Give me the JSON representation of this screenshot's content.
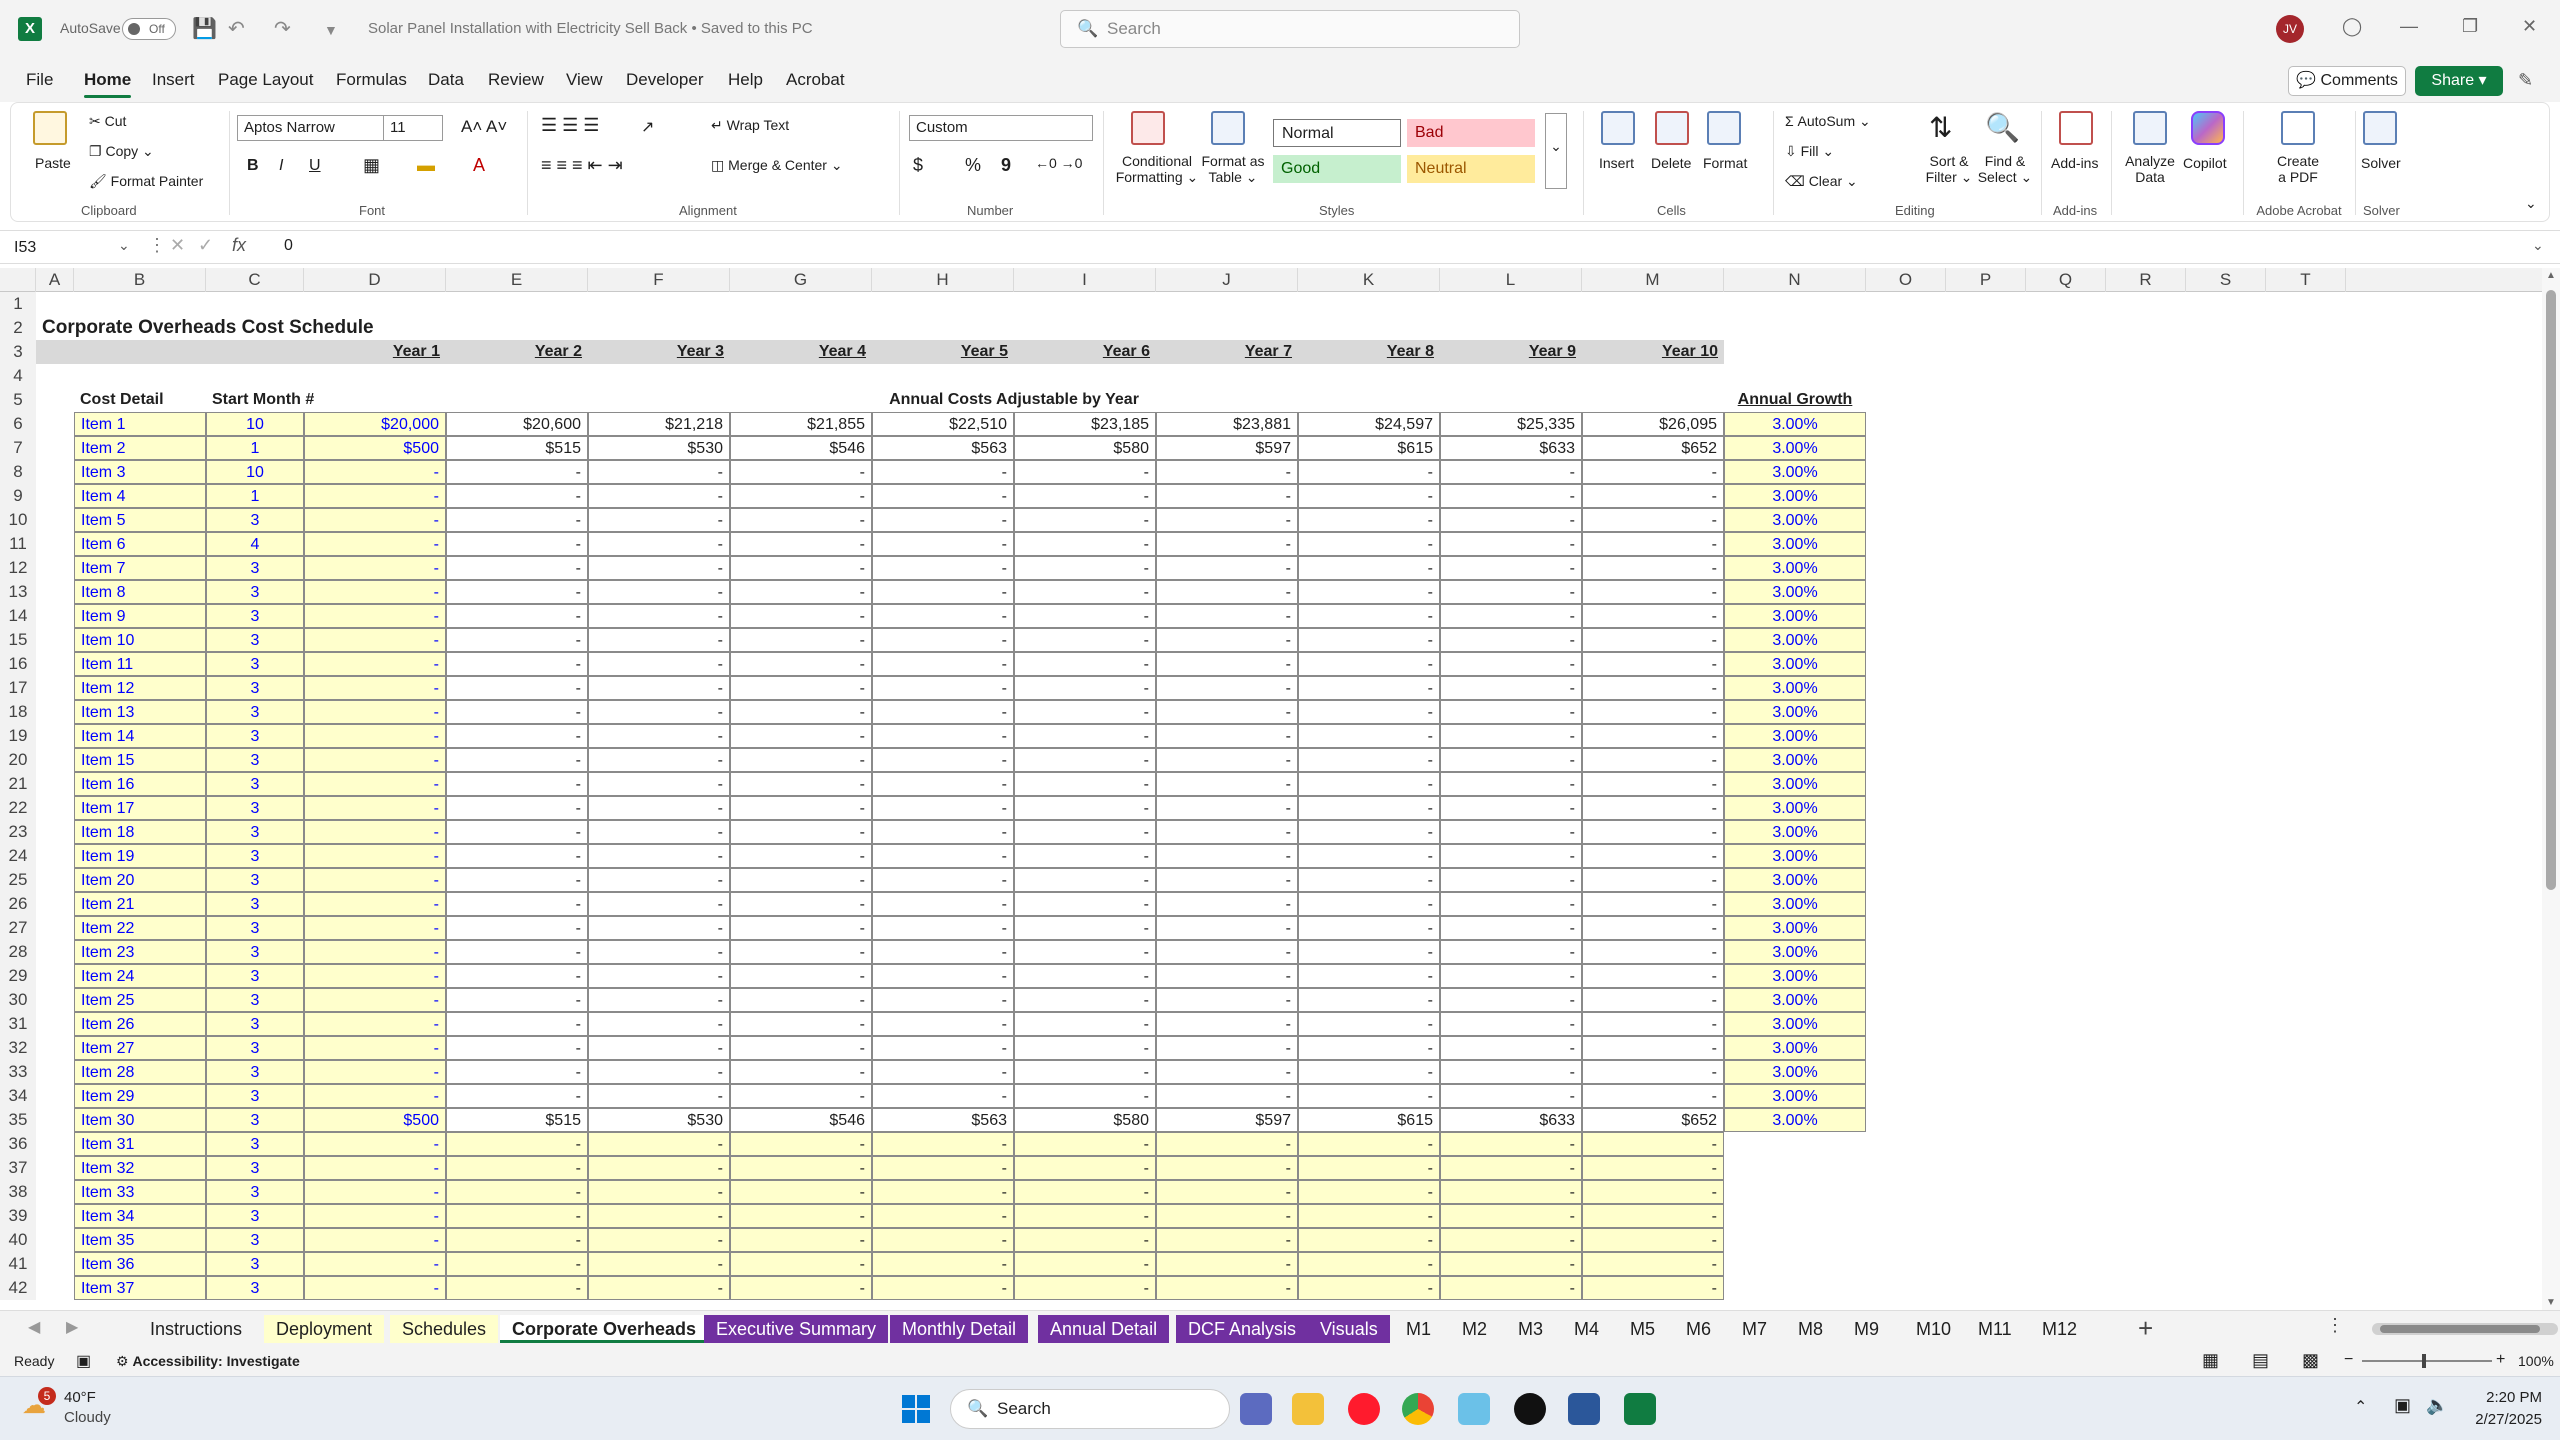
{
  "titlebar": {
    "app_icon": "X",
    "autosave_label": "AutoSave",
    "autosave_state": "Off",
    "document_title": "Solar Panel Installation with Electricity Sell Back • Saved to this PC",
    "search_placeholder": "Search",
    "user_initials": "JV"
  },
  "menu": [
    "File",
    "Home",
    "Insert",
    "Page Layout",
    "Formulas",
    "Data",
    "Review",
    "View",
    "Developer",
    "Help",
    "Acrobat"
  ],
  "menu_active": "Home",
  "actions": {
    "comments": "Comments",
    "share": "Share"
  },
  "ribbon": {
    "clipboard": {
      "paste": "Paste",
      "cut": "Cut",
      "copy": "Copy",
      "format_painter": "Format Painter",
      "label": "Clipboard"
    },
    "font": {
      "name": "Aptos Narrow",
      "size": "11",
      "bold": "B",
      "italic": "I",
      "underline": "U",
      "label": "Font"
    },
    "alignment": {
      "wrap": "Wrap Text",
      "merge": "Merge & Center",
      "label": "Alignment"
    },
    "number": {
      "format": "Custom",
      "currency": "$",
      "percent": "%",
      "comma": "9",
      "label": "Number"
    },
    "styles": {
      "conditional": "Conditional",
      "conditional2": "Formatting",
      "format_table": "Format as",
      "format_table2": "Table",
      "normal": "Normal",
      "bad": "Bad",
      "good": "Good",
      "neutral": "Neutral",
      "label": "Styles"
    },
    "cells": {
      "insert": "Insert",
      "delete": "Delete",
      "format": "Format",
      "label": "Cells"
    },
    "editing": {
      "autosum": "AutoSum",
      "fill": "Fill",
      "clear": "Clear",
      "sort": "Sort &",
      "sort2": "Filter",
      "find": "Find &",
      "find2": "Select",
      "label": "Editing"
    },
    "addins": {
      "addins": "Add-ins",
      "label": "Add-ins"
    },
    "analyze": {
      "line1": "Analyze",
      "line2": "Data"
    },
    "copilot": "Copilot",
    "acrobat": {
      "line1": "Create",
      "line2": "a PDF",
      "label": "Adobe Acrobat"
    },
    "solver": {
      "btn": "Solver",
      "label": "Solver"
    }
  },
  "formula_bar": {
    "cell_ref": "I53",
    "fx": "fx",
    "value": "0"
  },
  "columns": [
    "A",
    "B",
    "C",
    "D",
    "E",
    "F",
    "G",
    "H",
    "I",
    "J",
    "K",
    "L",
    "M",
    "N",
    "O",
    "P",
    "Q",
    "R",
    "S",
    "T"
  ],
  "sheet": {
    "title": "Corporate Overheads Cost Schedule",
    "years": [
      "Year 1",
      "Year 2",
      "Year 3",
      "Year 4",
      "Year 5",
      "Year 6",
      "Year 7",
      "Year 8",
      "Year 9",
      "Year 10"
    ],
    "cost_detail_label": "Cost Detail",
    "start_month_label": "Start Month #",
    "annual_costs_label": "Annual Costs Adjustable by Year",
    "annual_growth_label": "Annual Growth",
    "items": [
      {
        "name": "Item 1",
        "start": "10",
        "vals": [
          "$20,000",
          "$20,600",
          "$21,218",
          "$21,855",
          "$22,510",
          "$23,185",
          "$23,881",
          "$24,597",
          "$25,335",
          "$26,095"
        ],
        "growth": "3.00%"
      },
      {
        "name": "Item 2",
        "start": "1",
        "vals": [
          "$500",
          "$515",
          "$530",
          "$546",
          "$563",
          "$580",
          "$597",
          "$615",
          "$633",
          "$652"
        ],
        "growth": "3.00%"
      },
      {
        "name": "Item 3",
        "start": "10",
        "vals": [
          "-",
          "-",
          "-",
          "-",
          "-",
          "-",
          "-",
          "-",
          "-",
          "-"
        ],
        "growth": "3.00%"
      },
      {
        "name": "Item 4",
        "start": "1",
        "vals": [
          "-",
          "-",
          "-",
          "-",
          "-",
          "-",
          "-",
          "-",
          "-",
          "-"
        ],
        "growth": "3.00%"
      },
      {
        "name": "Item 5",
        "start": "3",
        "vals": [
          "-",
          "-",
          "-",
          "-",
          "-",
          "-",
          "-",
          "-",
          "-",
          "-"
        ],
        "growth": "3.00%"
      },
      {
        "name": "Item 6",
        "start": "4",
        "vals": [
          "-",
          "-",
          "-",
          "-",
          "-",
          "-",
          "-",
          "-",
          "-",
          "-"
        ],
        "growth": "3.00%"
      },
      {
        "name": "Item 7",
        "start": "3",
        "vals": [
          "-",
          "-",
          "-",
          "-",
          "-",
          "-",
          "-",
          "-",
          "-",
          "-"
        ],
        "growth": "3.00%"
      },
      {
        "name": "Item 8",
        "start": "3",
        "vals": [
          "-",
          "-",
          "-",
          "-",
          "-",
          "-",
          "-",
          "-",
          "-",
          "-"
        ],
        "growth": "3.00%"
      },
      {
        "name": "Item 9",
        "start": "3",
        "vals": [
          "-",
          "-",
          "-",
          "-",
          "-",
          "-",
          "-",
          "-",
          "-",
          "-"
        ],
        "growth": "3.00%"
      },
      {
        "name": "Item 10",
        "start": "3",
        "vals": [
          "-",
          "-",
          "-",
          "-",
          "-",
          "-",
          "-",
          "-",
          "-",
          "-"
        ],
        "growth": "3.00%"
      },
      {
        "name": "Item 11",
        "start": "3",
        "vals": [
          "-",
          "-",
          "-",
          "-",
          "-",
          "-",
          "-",
          "-",
          "-",
          "-"
        ],
        "growth": "3.00%"
      },
      {
        "name": "Item 12",
        "start": "3",
        "vals": [
          "-",
          "-",
          "-",
          "-",
          "-",
          "-",
          "-",
          "-",
          "-",
          "-"
        ],
        "growth": "3.00%"
      },
      {
        "name": "Item 13",
        "start": "3",
        "vals": [
          "-",
          "-",
          "-",
          "-",
          "-",
          "-",
          "-",
          "-",
          "-",
          "-"
        ],
        "growth": "3.00%"
      },
      {
        "name": "Item 14",
        "start": "3",
        "vals": [
          "-",
          "-",
          "-",
          "-",
          "-",
          "-",
          "-",
          "-",
          "-",
          "-"
        ],
        "growth": "3.00%"
      },
      {
        "name": "Item 15",
        "start": "3",
        "vals": [
          "-",
          "-",
          "-",
          "-",
          "-",
          "-",
          "-",
          "-",
          "-",
          "-"
        ],
        "growth": "3.00%"
      },
      {
        "name": "Item 16",
        "start": "3",
        "vals": [
          "-",
          "-",
          "-",
          "-",
          "-",
          "-",
          "-",
          "-",
          "-",
          "-"
        ],
        "growth": "3.00%"
      },
      {
        "name": "Item 17",
        "start": "3",
        "vals": [
          "-",
          "-",
          "-",
          "-",
          "-",
          "-",
          "-",
          "-",
          "-",
          "-"
        ],
        "growth": "3.00%"
      },
      {
        "name": "Item 18",
        "start": "3",
        "vals": [
          "-",
          "-",
          "-",
          "-",
          "-",
          "-",
          "-",
          "-",
          "-",
          "-"
        ],
        "growth": "3.00%"
      },
      {
        "name": "Item 19",
        "start": "3",
        "vals": [
          "-",
          "-",
          "-",
          "-",
          "-",
          "-",
          "-",
          "-",
          "-",
          "-"
        ],
        "growth": "3.00%"
      },
      {
        "name": "Item 20",
        "start": "3",
        "vals": [
          "-",
          "-",
          "-",
          "-",
          "-",
          "-",
          "-",
          "-",
          "-",
          "-"
        ],
        "growth": "3.00%"
      },
      {
        "name": "Item 21",
        "start": "3",
        "vals": [
          "-",
          "-",
          "-",
          "-",
          "-",
          "-",
          "-",
          "-",
          "-",
          "-"
        ],
        "growth": "3.00%"
      },
      {
        "name": "Item 22",
        "start": "3",
        "vals": [
          "-",
          "-",
          "-",
          "-",
          "-",
          "-",
          "-",
          "-",
          "-",
          "-"
        ],
        "growth": "3.00%"
      },
      {
        "name": "Item 23",
        "start": "3",
        "vals": [
          "-",
          "-",
          "-",
          "-",
          "-",
          "-",
          "-",
          "-",
          "-",
          "-"
        ],
        "growth": "3.00%"
      },
      {
        "name": "Item 24",
        "start": "3",
        "vals": [
          "-",
          "-",
          "-",
          "-",
          "-",
          "-",
          "-",
          "-",
          "-",
          "-"
        ],
        "growth": "3.00%"
      },
      {
        "name": "Item 25",
        "start": "3",
        "vals": [
          "-",
          "-",
          "-",
          "-",
          "-",
          "-",
          "-",
          "-",
          "-",
          "-"
        ],
        "growth": "3.00%"
      },
      {
        "name": "Item 26",
        "start": "3",
        "vals": [
          "-",
          "-",
          "-",
          "-",
          "-",
          "-",
          "-",
          "-",
          "-",
          "-"
        ],
        "growth": "3.00%"
      },
      {
        "name": "Item 27",
        "start": "3",
        "vals": [
          "-",
          "-",
          "-",
          "-",
          "-",
          "-",
          "-",
          "-",
          "-",
          "-"
        ],
        "growth": "3.00%"
      },
      {
        "name": "Item 28",
        "start": "3",
        "vals": [
          "-",
          "-",
          "-",
          "-",
          "-",
          "-",
          "-",
          "-",
          "-",
          "-"
        ],
        "growth": "3.00%"
      },
      {
        "name": "Item 29",
        "start": "3",
        "vals": [
          "-",
          "-",
          "-",
          "-",
          "-",
          "-",
          "-",
          "-",
          "-",
          "-"
        ],
        "growth": "3.00%"
      },
      {
        "name": "Item 30",
        "start": "3",
        "vals": [
          "$500",
          "$515",
          "$530",
          "$546",
          "$563",
          "$580",
          "$597",
          "$615",
          "$633",
          "$652"
        ],
        "growth": "3.00%"
      },
      {
        "name": "Item 31",
        "start": "3",
        "vals": [
          "-",
          "-",
          "-",
          "-",
          "-",
          "-",
          "-",
          "-",
          "-",
          "-"
        ],
        "growth": ""
      },
      {
        "name": "Item 32",
        "start": "3",
        "vals": [
          "-",
          "-",
          "-",
          "-",
          "-",
          "-",
          "-",
          "-",
          "-",
          "-"
        ],
        "growth": ""
      },
      {
        "name": "Item 33",
        "start": "3",
        "vals": [
          "-",
          "-",
          "-",
          "-",
          "-",
          "-",
          "-",
          "-",
          "-",
          "-"
        ],
        "growth": ""
      },
      {
        "name": "Item 34",
        "start": "3",
        "vals": [
          "-",
          "-",
          "-",
          "-",
          "-",
          "-",
          "-",
          "-",
          "-",
          "-"
        ],
        "growth": ""
      },
      {
        "name": "Item 35",
        "start": "3",
        "vals": [
          "-",
          "-",
          "-",
          "-",
          "-",
          "-",
          "-",
          "-",
          "-",
          "-"
        ],
        "growth": ""
      },
      {
        "name": "Item 36",
        "start": "3",
        "vals": [
          "-",
          "-",
          "-",
          "-",
          "-",
          "-",
          "-",
          "-",
          "-",
          "-"
        ],
        "growth": ""
      },
      {
        "name": "Item 37",
        "start": "3",
        "vals": [
          "-",
          "-",
          "-",
          "-",
          "-",
          "-",
          "-",
          "-",
          "-",
          "-"
        ],
        "growth": ""
      }
    ]
  },
  "tabs": [
    {
      "label": "Instructions",
      "style": "plain"
    },
    {
      "label": "Deployment",
      "style": "yel"
    },
    {
      "label": "Schedules",
      "style": "yel"
    },
    {
      "label": "Corporate Overheads",
      "style": "active"
    },
    {
      "label": "Executive Summary",
      "style": "pur"
    },
    {
      "label": "Monthly Detail",
      "style": "pur"
    },
    {
      "label": "Annual Detail",
      "style": "pur"
    },
    {
      "label": "DCF Analysis",
      "style": "pur"
    },
    {
      "label": "Visuals",
      "style": "pur"
    },
    {
      "label": "M1",
      "style": "plain"
    },
    {
      "label": "M2",
      "style": "plain"
    },
    {
      "label": "M3",
      "style": "plain"
    },
    {
      "label": "M4",
      "style": "plain"
    },
    {
      "label": "M5",
      "style": "plain"
    },
    {
      "label": "M6",
      "style": "plain"
    },
    {
      "label": "M7",
      "style": "plain"
    },
    {
      "label": "M8",
      "style": "plain"
    },
    {
      "label": "M9",
      "style": "plain"
    },
    {
      "label": "M10",
      "style": "plain"
    },
    {
      "label": "M11",
      "style": "plain"
    },
    {
      "label": "M12",
      "style": "plain"
    }
  ],
  "status": {
    "ready": "Ready",
    "accessibility": "Accessibility: Investigate",
    "zoom": "100%"
  },
  "taskbar": {
    "weather_temp": "40°F",
    "weather_desc": "Cloudy",
    "weather_badge": "5",
    "search": "Search",
    "time": "2:20 PM",
    "date": "2/27/2025"
  },
  "colors": {
    "accent": "#107c41",
    "input_yellow": "#ffffcc",
    "tab_purple": "#7030a0",
    "input_blue": "#0000ff"
  }
}
